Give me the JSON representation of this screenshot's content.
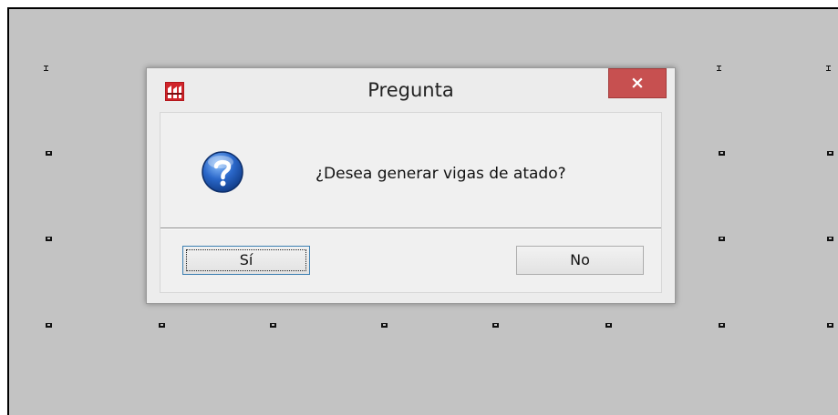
{
  "dialog": {
    "title": "Pregunta",
    "close_label": "×",
    "message": "¿Desea generar vigas de atado?",
    "icon": "question-icon",
    "app_icon": "app-icon",
    "buttons": {
      "yes_label": "Sí",
      "no_label": "No"
    }
  },
  "colors": {
    "canvas_background": "#c3c3c3",
    "close_button": "#c75050",
    "dialog_background": "#ececec"
  }
}
